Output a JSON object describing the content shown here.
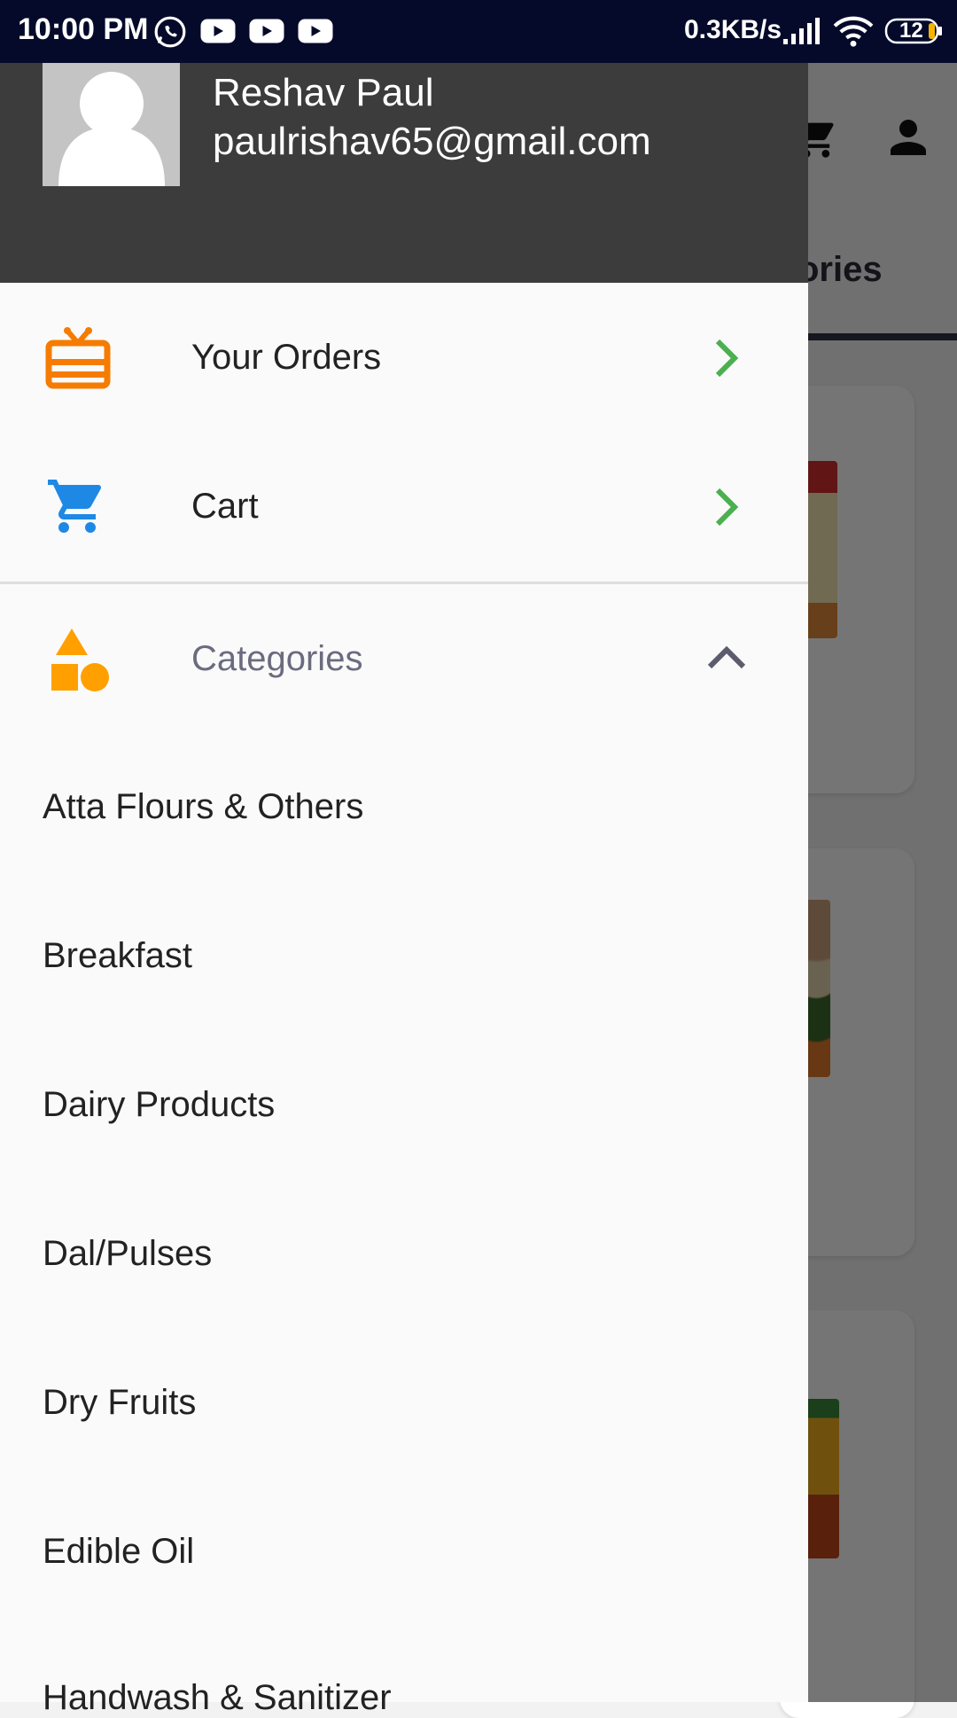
{
  "status_bar": {
    "time": "10:00 PM",
    "network_speed": "0.3KB/s",
    "battery": "12",
    "notification_icons": [
      "whatsapp-icon",
      "youtube-icon",
      "youtube-icon",
      "youtube-icon"
    ]
  },
  "drawer": {
    "user": {
      "name": "Reshav Paul",
      "email": "paulrishav65@gmail.com"
    },
    "menu": [
      {
        "label": "Your Orders",
        "icon": "gift-box-icon",
        "icon_color": "#f57c00"
      },
      {
        "label": "Cart",
        "icon": "cart-icon",
        "icon_color": "#1e88e5"
      }
    ],
    "categories_section": {
      "label": "Categories",
      "icon": "shapes-icon",
      "icon_color": "#ffa000",
      "expanded": true,
      "items": [
        "Atta Flours & Others",
        "Breakfast",
        "Dairy Products",
        "Dal/Pulses",
        "Dry Fruits",
        "Edible Oil",
        "Handwash & Sanitizer"
      ]
    }
  },
  "background": {
    "tab_partial": "ories"
  },
  "colors": {
    "status_bar": "#050a2a",
    "drawer_header": "#3c3c3c",
    "chevron": "#4caf50"
  }
}
